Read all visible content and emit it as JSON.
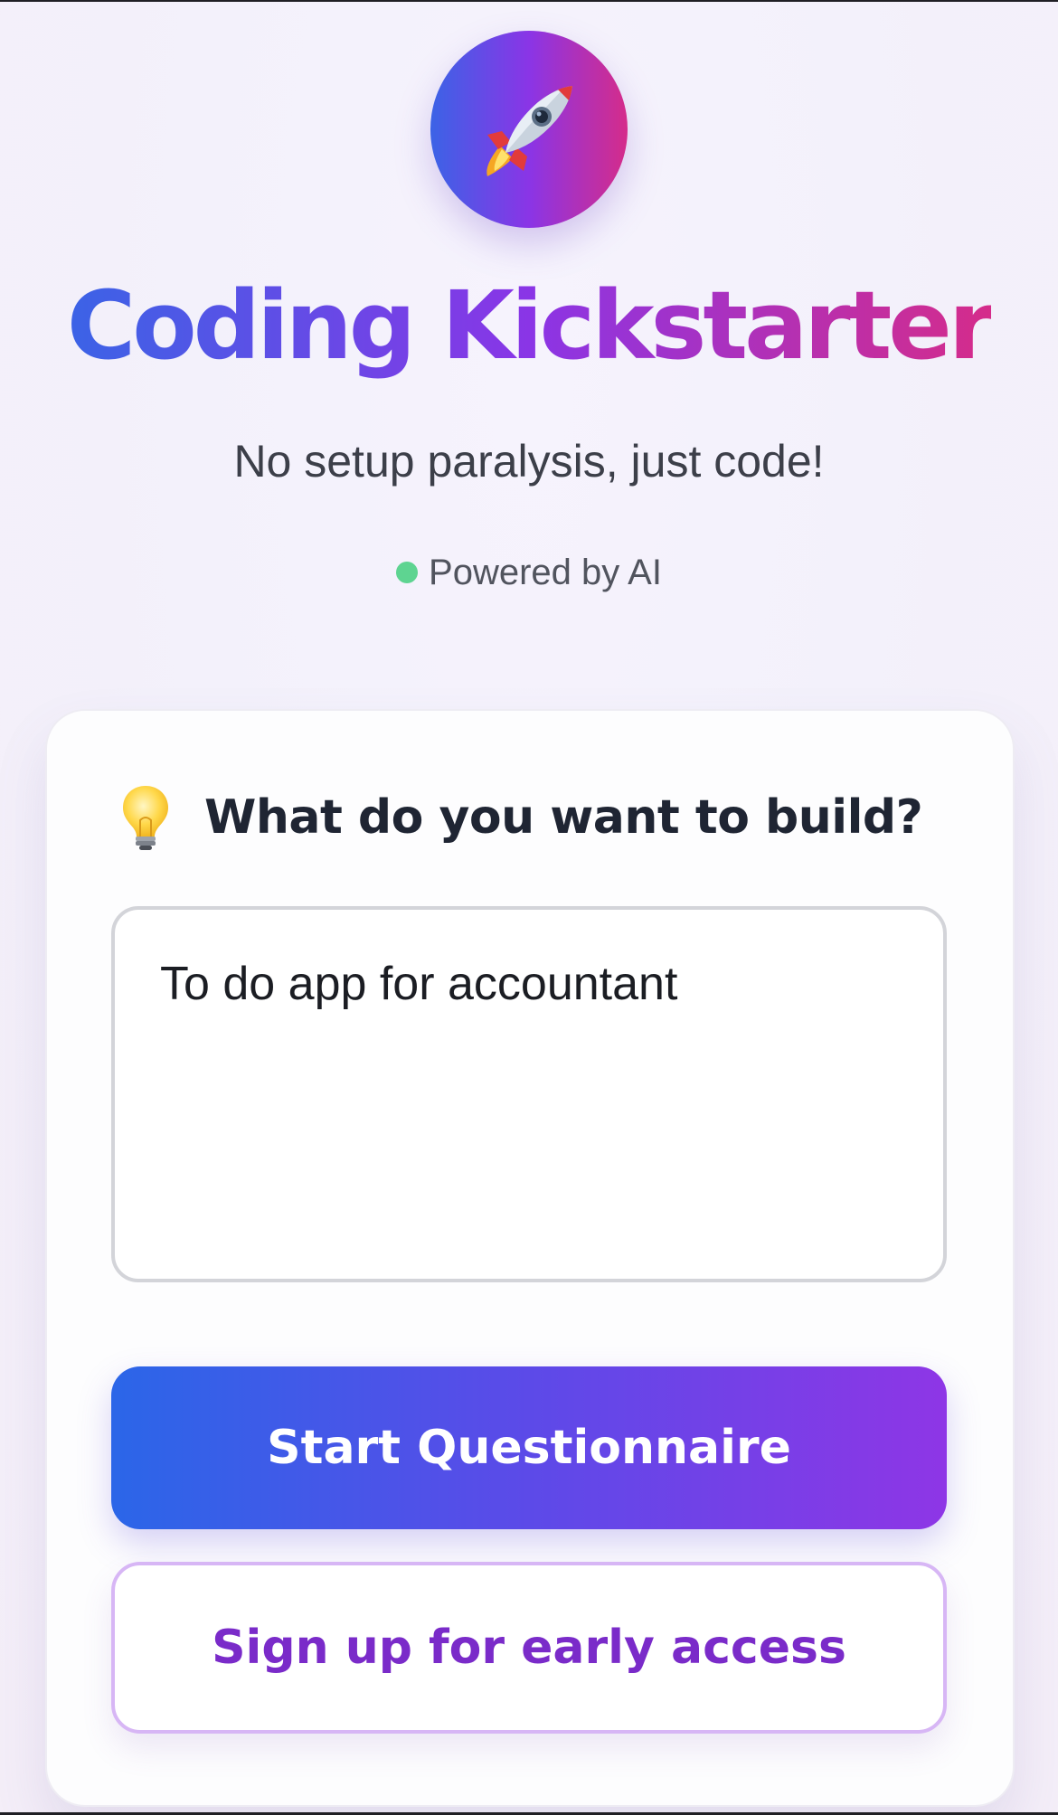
{
  "app": {
    "logo_icon": "rocket-icon",
    "title": "Coding Kickstarter",
    "subtitle": "No setup paralysis, just code!",
    "powered_by": "Powered by AI"
  },
  "card": {
    "question_icon": "lightbulb-icon",
    "question": "What do you want to build?",
    "input_value": "To do app for accountant",
    "primary_button": "Start Questionnaire",
    "secondary_button": "Sign up for early access"
  },
  "colors": {
    "gradient_start": "#3b63e6",
    "gradient_mid": "#8a35e6",
    "gradient_end": "#d52c8a",
    "status_green": "#5ed491",
    "secondary_text": "#7a2bc9",
    "secondary_border": "#d7b6f5"
  }
}
